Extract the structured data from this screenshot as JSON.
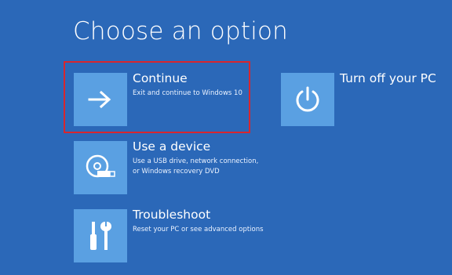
{
  "page": {
    "title": "Choose an option"
  },
  "options": {
    "continue": {
      "label": "Continue",
      "desc": "Exit and continue to Windows 10",
      "icon": "arrow-right-icon"
    },
    "use_device": {
      "label": "Use a device",
      "desc": "Use a USB drive, network connection, or Windows recovery DVD",
      "icon": "disc-usb-icon"
    },
    "troubleshoot": {
      "label": "Troubleshoot",
      "desc": "Reset your PC or see advanced options",
      "icon": "tools-icon"
    },
    "turn_off": {
      "label": "Turn off your PC",
      "icon": "power-icon"
    }
  },
  "colors": {
    "background": "#2b68b8",
    "tile": "#5aa0e2",
    "highlight": "#d8262e"
  }
}
